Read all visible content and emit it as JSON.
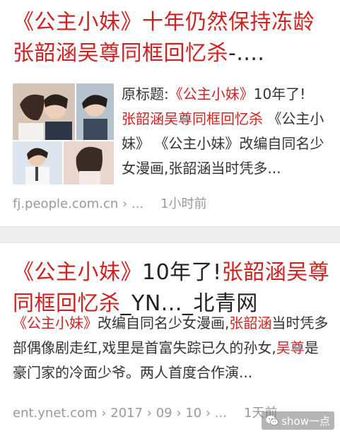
{
  "results": [
    {
      "title_red_1": "《公主小妹》十年仍然保持冻龄",
      "title_red_2": "张韶涵吴尊同框回忆杀",
      "title_dark_2": "-....",
      "snippet": {
        "t1": "原标题:",
        "t2": "《公主小妹》",
        "t3": "10年了!",
        "t4": "张韶涵吴尊同框回忆杀",
        "t5": " 《公主小妹》 《公主小妹》改编自同名少女漫画,张韶涵当时凭多..."
      },
      "source": "fj.people.com.cn › ...",
      "time": "1小时前"
    },
    {
      "title_red_1": "《公主小妹》",
      "title_dark_1": "10年了!",
      "title_red_2": "张韶涵吴尊",
      "title_red_3": "同框回忆杀",
      "title_dark_3": "_YN..._北青网",
      "snippet": {
        "t1": "《公主小妹》",
        "t2": "改编自同名少女漫画,",
        "t3": "张韶涵",
        "t4": "当时凭多部偶像剧走红,戏里是首富失踪已久的孙女,",
        "t5": "吴尊",
        "t6": "是豪门家的冷面少爷。两人首度合作演..."
      },
      "source": "ent.ynet.com › 2017 › 09 › 10 › ...",
      "time": "1天前"
    }
  ],
  "watermark": {
    "icon": "wechat-logo-icon",
    "text": "show一点"
  },
  "colors": {
    "title_red": "#cc2222",
    "text": "#333333",
    "meta": "#999999",
    "divider": "#ededed"
  }
}
